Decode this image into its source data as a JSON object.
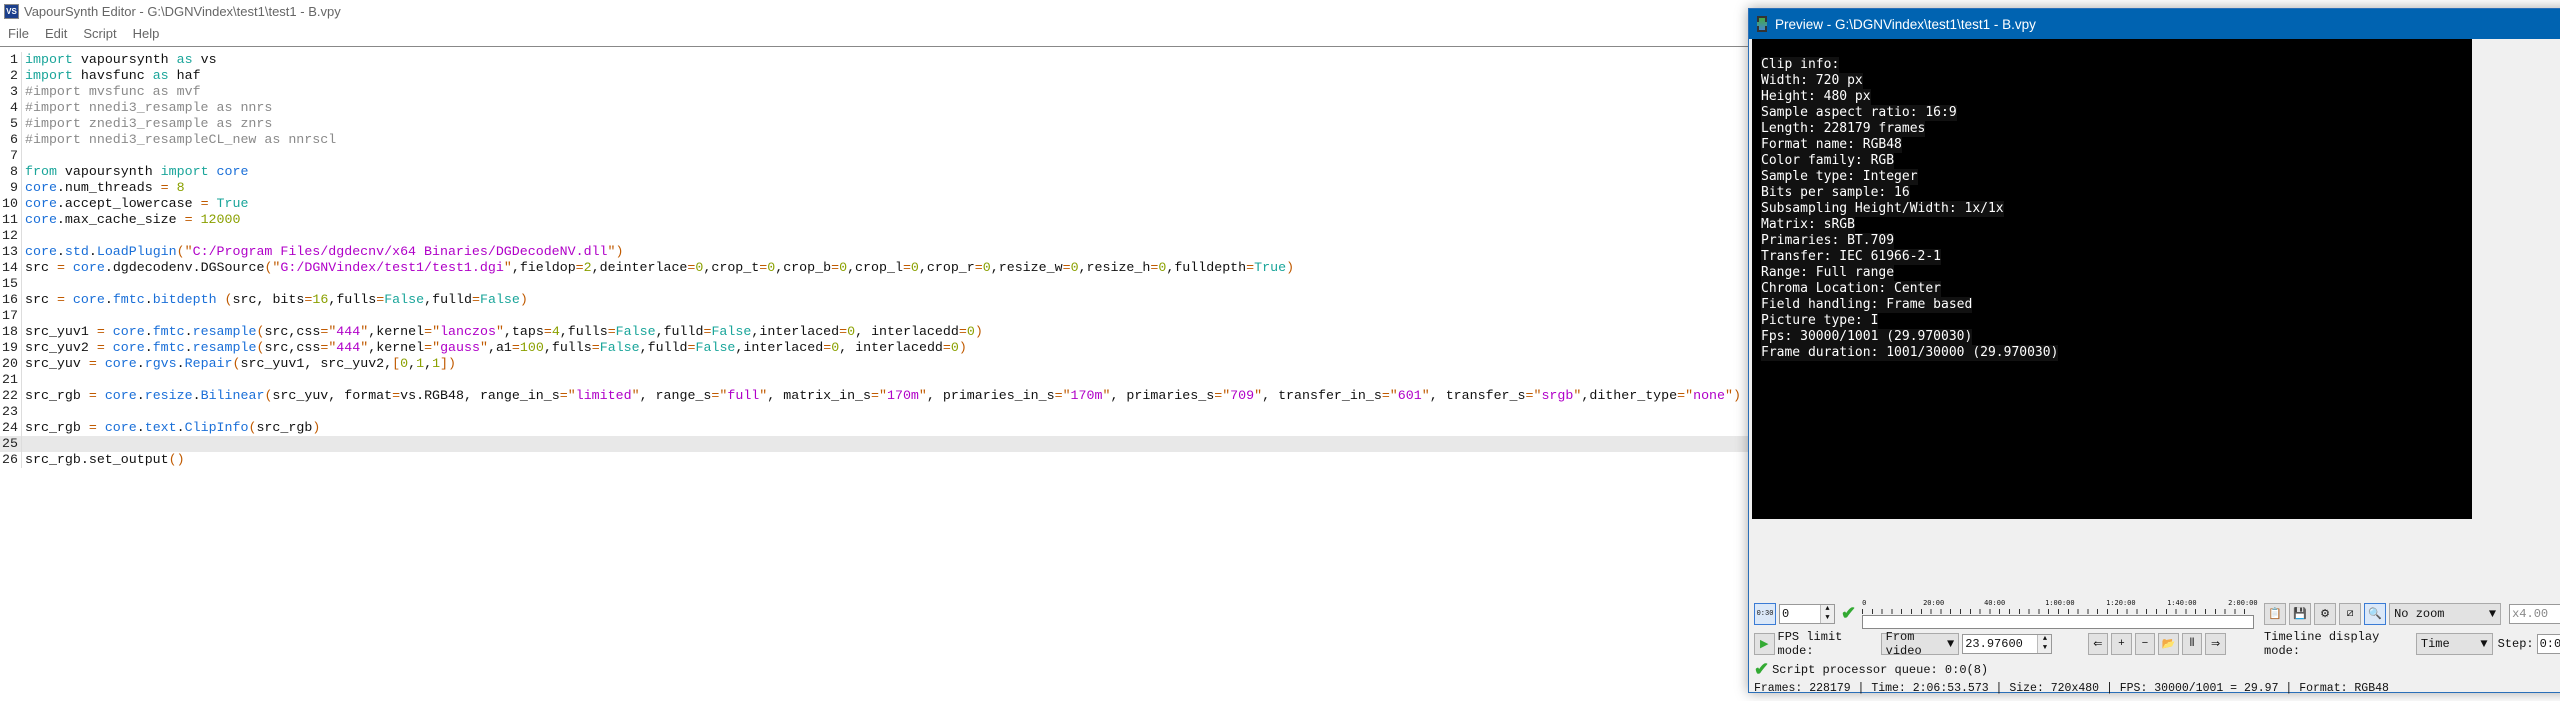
{
  "editor": {
    "title": "VapourSynth Editor - G:\\DGNVindex\\test1\\test1 - B.vpy",
    "logo": "VS",
    "menu": [
      "File",
      "Edit",
      "Script",
      "Help"
    ],
    "current_line": 25,
    "lines": [
      "import vapoursynth as vs",
      "import havsfunc as haf",
      "#import mvsfunc as mvf",
      "#import nnedi3_resample as nnrs",
      "#import znedi3_resample as znrs",
      "#import nnedi3_resampleCL_new as nnrscl",
      "",
      "from vapoursynth import core",
      "core.num_threads = 8",
      "core.accept_lowercase = True",
      "core.max_cache_size = 12000",
      "",
      "core.std.LoadPlugin(\"C:/Program Files/dgdecnv/x64 Binaries/DGDecodeNV.dll\")",
      "src = core.dgdecodenv.DGSource(\"G:/DGNVindex/test1/test1.dgi\",fieldop=2,deinterlace=0,crop_t=0,crop_b=0,crop_l=0,crop_r=0,resize_w=0,resize_h=0,fulldepth=True)",
      "",
      "src = core.fmtc.bitdepth (src, bits=16,fulls=False,fulld=False)",
      "",
      "src_yuv1 = core.fmtc.resample(src,css=\"444\",kernel=\"lanczos\",taps=4,fulls=False,fulld=False,interlaced=0, interlacedd=0)",
      "src_yuv2 = core.fmtc.resample(src,css=\"444\",kernel=\"gauss\",a1=100,fulls=False,fulld=False,interlaced=0, interlacedd=0)",
      "src_yuv = core.rgvs.Repair(src_yuv1, src_yuv2,[0,1,1])",
      "",
      "src_rgb = core.resize.Bilinear(src_yuv, format=vs.RGB48, range_in_s=\"limited\", range_s=\"full\", matrix_in_s=\"170m\", primaries_in_s=\"170m\", primaries_s=\"709\", transfer_in_s=\"601\", transfer_s=\"srgb\",dither_type=\"none\")",
      "",
      "src_rgb = core.text.ClipInfo(src_rgb)",
      "",
      "src_rgb.set_output()"
    ]
  },
  "preview": {
    "title": "Preview - G:\\DGNVindex\\test1\\test1 - B.vpy",
    "clip_info": [
      "Clip info:",
      "Width: 720 px",
      "Height: 480 px",
      "Sample aspect ratio: 16:9",
      "Length: 228179 frames",
      "Format name: RGB48",
      "Color family: RGB",
      "Sample type: Integer",
      "Bits per sample: 16",
      "Subsampling Height/Width: 1x/1x",
      "Matrix: sRGB",
      "Primaries: BT.709",
      "Transfer: IEC 61966-2-1",
      "Range: Full range",
      "Chroma Location: Center",
      "Field handling: Frame based",
      "Picture type: I",
      "Fps: 30000/1001 (29.970030)",
      "Frame duration: 1001/30000 (29.970030)"
    ],
    "frame_value": "0",
    "timeline_ticks": [
      "0",
      "20:00",
      "40:00",
      "1:00:00",
      "1:20:00",
      "1:40:00",
      "2:00:00"
    ],
    "timeline_position": 0,
    "zoom_mode": "No zoom",
    "zoom_ratio": "x4.00",
    "fps_limit_label": "FPS limit mode:",
    "fps_limit_mode": "From video",
    "fps_value": "23.97600",
    "timeline_mode_label": "Timeline display mode:",
    "timeline_mode": "Time",
    "step_label": "Step:",
    "step_value": "0:0",
    "timecode_icon_text": "0:30",
    "queue_status": "Script processor queue: 0:0(8)",
    "status_line": "Frames: 228179 | Time: 2:06:53.573 | Size: 720x480 | FPS: 30000/1001 = 29.97 | Format: RGB48"
  }
}
